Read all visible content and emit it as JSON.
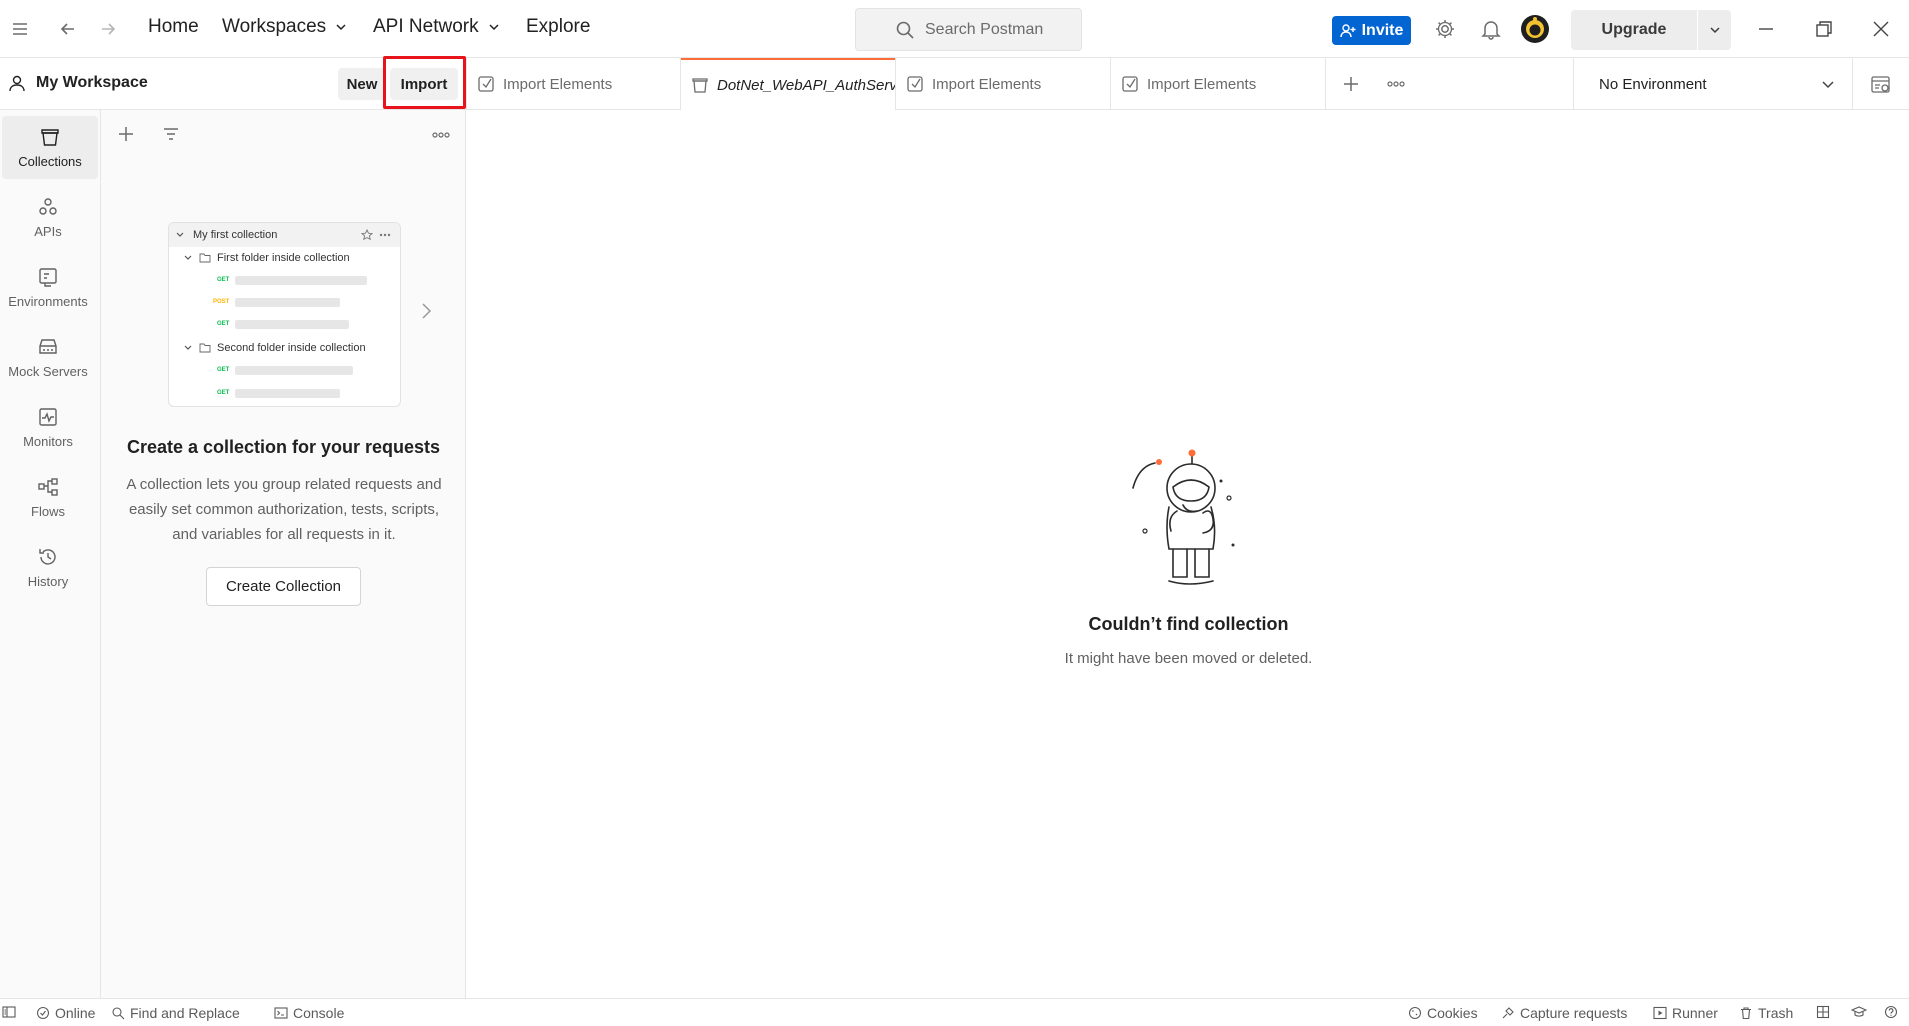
{
  "header": {
    "nav": {
      "home": "Home",
      "workspaces": "Workspaces",
      "api_network": "API Network",
      "explore": "Explore"
    },
    "search_placeholder": "Search Postman",
    "invite_label": "Invite",
    "upgrade_label": "Upgrade"
  },
  "workspace": {
    "title": "My Workspace",
    "new_label": "New",
    "import_label": "Import"
  },
  "tabs": [
    {
      "label": "Import Elements",
      "icon": "import-icon",
      "active": false
    },
    {
      "label": "DotNet_WebAPI_AuthServ",
      "icon": "collection-icon",
      "active": true
    },
    {
      "label": "Import Elements",
      "icon": "import-icon",
      "active": false
    },
    {
      "label": "Import Elements",
      "icon": "import-icon",
      "active": false
    }
  ],
  "environment": {
    "selected": "No Environment"
  },
  "rail": [
    {
      "label": "Collections",
      "icon": "collections-icon",
      "active": true
    },
    {
      "label": "APIs",
      "icon": "apis-icon",
      "active": false
    },
    {
      "label": "Environments",
      "icon": "environments-icon",
      "active": false
    },
    {
      "label": "Mock Servers",
      "icon": "mock-servers-icon",
      "active": false
    },
    {
      "label": "Monitors",
      "icon": "monitors-icon",
      "active": false
    },
    {
      "label": "Flows",
      "icon": "flows-icon",
      "active": false
    },
    {
      "label": "History",
      "icon": "history-icon",
      "active": false
    }
  ],
  "preview": {
    "collection": "My first collection",
    "folder1": "First folder inside collection",
    "folder2": "Second folder inside collection",
    "methods": [
      "GET",
      "POST",
      "GET",
      "GET",
      "GET"
    ]
  },
  "sidebar_empty": {
    "title": "Create a collection for your requests",
    "description": "A collection lets you group related requests and easily set common authorization, tests, scripts, and variables for all requests in it.",
    "button": "Create Collection"
  },
  "main_empty": {
    "title": "Couldn’t find collection",
    "description": "It might have been moved or deleted."
  },
  "statusbar": {
    "online": "Online",
    "find_replace": "Find and Replace",
    "console": "Console",
    "cookies": "Cookies",
    "capture": "Capture requests",
    "runner": "Runner",
    "trash": "Trash"
  },
  "colors": {
    "accent": "#ff6c37",
    "invite_bg": "#0265d2",
    "highlight": "#e8141b",
    "method_get": "#0cbb52",
    "method_post": "#ffb400"
  }
}
